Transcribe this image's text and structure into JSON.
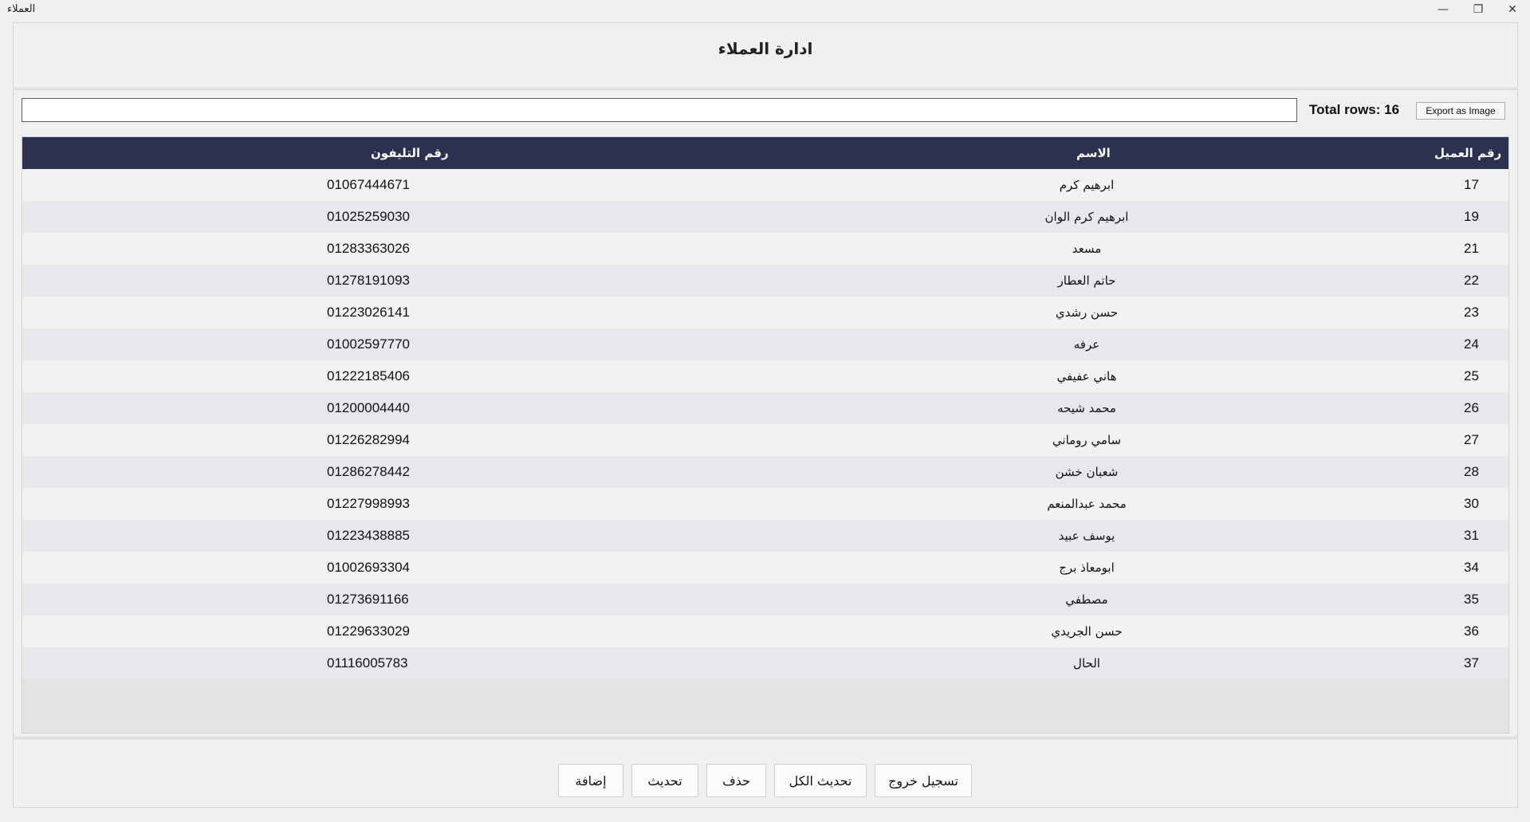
{
  "window": {
    "title": "العملاء",
    "minimize_glyph": "—",
    "maximize_glyph": "❐",
    "close_glyph": "✕"
  },
  "header": {
    "title": "ادارة العملاء"
  },
  "toolbar": {
    "search_value": "",
    "total_rows_label": "Total rows: 16",
    "export_label": "Export as Image"
  },
  "table": {
    "columns": {
      "id": "رقم العميل",
      "name": "الاسم",
      "phone": "رقم التليفون"
    },
    "rows": [
      {
        "id": "17",
        "name": "ابرهيم كرم",
        "phone": "01067444671"
      },
      {
        "id": "19",
        "name": "ابرهيم كرم الوان",
        "phone": "01025259030"
      },
      {
        "id": "21",
        "name": "مسعد",
        "phone": "01283363026"
      },
      {
        "id": "22",
        "name": "حاتم العطار",
        "phone": "01278191093"
      },
      {
        "id": "23",
        "name": "حسن رشدي",
        "phone": "01223026141"
      },
      {
        "id": "24",
        "name": "عرفه",
        "phone": "01002597770"
      },
      {
        "id": "25",
        "name": "هاني عفيفي",
        "phone": "01222185406"
      },
      {
        "id": "26",
        "name": "محمد شيحه",
        "phone": "01200004440"
      },
      {
        "id": "27",
        "name": "سامي روماني",
        "phone": "01226282994"
      },
      {
        "id": "28",
        "name": "شعبان خشن",
        "phone": "01286278442"
      },
      {
        "id": "30",
        "name": "محمد عبدالمنعم",
        "phone": "01227998993"
      },
      {
        "id": "31",
        "name": "يوسف عبيد",
        "phone": "01223438885"
      },
      {
        "id": "34",
        "name": "ابومعاذ برج",
        "phone": "01002693304"
      },
      {
        "id": "35",
        "name": "مصطفي",
        "phone": "01273691166"
      },
      {
        "id": "36",
        "name": "حسن الجريدي",
        "phone": "01229633029"
      },
      {
        "id": "37",
        "name": "الحال",
        "phone": "01116005783"
      }
    ]
  },
  "footer": {
    "add_label": "إضافة",
    "update_label": "تحديث",
    "delete_label": "حذف",
    "refresh_all_label": "تحديث الكل",
    "logout_label": "تسجيل خروج"
  },
  "colors": {
    "header_bg": "#2c3150",
    "row_odd": "#f2f2f2",
    "row_even": "#e6e8ec"
  }
}
